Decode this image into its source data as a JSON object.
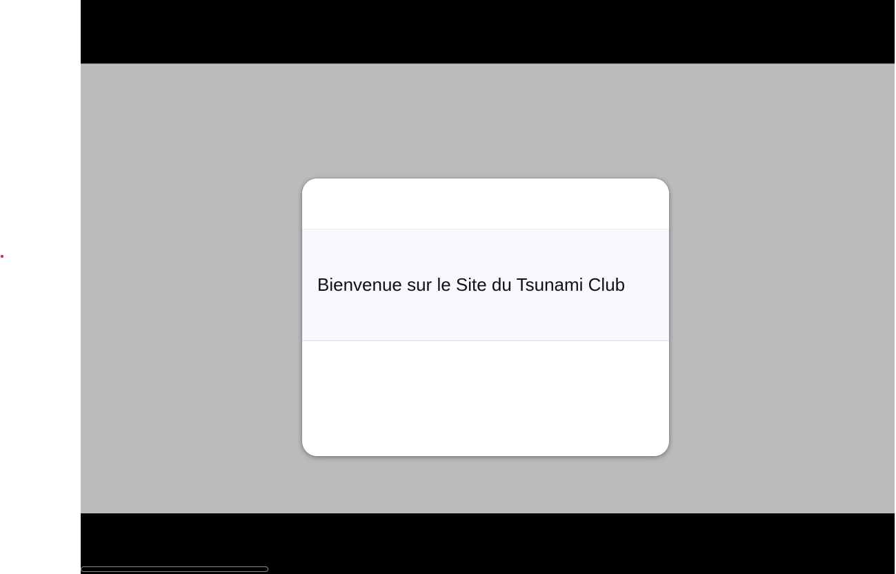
{
  "modal": {
    "title": "Bienvenue sur le Site du Tsunami Club"
  },
  "colors": {
    "overlay": "#bbbbbb",
    "band": "#f7f7fc",
    "accent_dot": "#e0203a",
    "frame": "#000000"
  }
}
